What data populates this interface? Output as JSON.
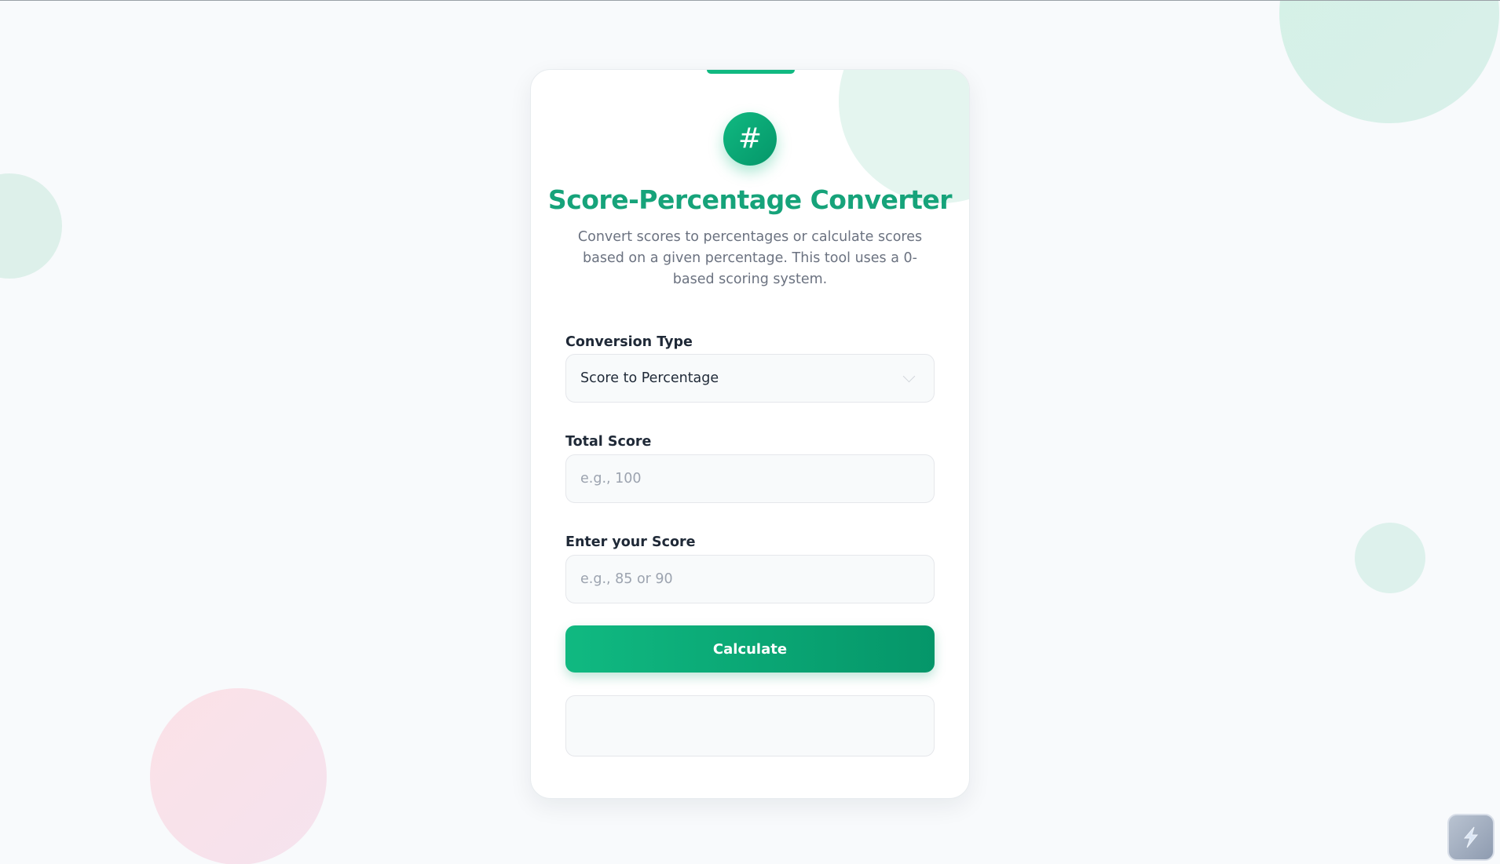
{
  "app": {
    "title": "Score-Percentage Converter",
    "description": "Convert scores to percentages or calculate scores based on a given percentage. This tool uses a 0-based scoring system.",
    "logo_glyph": "#"
  },
  "form": {
    "conversion_type": {
      "label": "Conversion Type",
      "value": "Score to Percentage"
    },
    "total_score": {
      "label": "Total Score",
      "placeholder": "e.g., 100",
      "value": ""
    },
    "your_score": {
      "label": "Enter your Score",
      "placeholder": "e.g., 85 or 90",
      "value": ""
    },
    "calculate_label": "Calculate",
    "result": ""
  },
  "colors": {
    "accent": "#10b981",
    "accent_dark": "#059669",
    "title": "#16a37a",
    "background": "#f8fafc"
  },
  "icons": {
    "logo": "hash-icon",
    "select_arrow": "chevron-down-icon",
    "corner_widget": "lightning-icon"
  }
}
